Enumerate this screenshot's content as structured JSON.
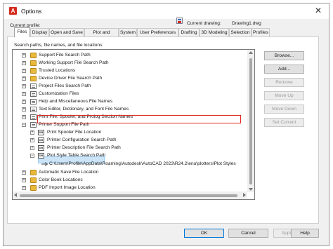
{
  "window": {
    "title": "Options",
    "close_glyph": "✕"
  },
  "header": {
    "current_profile_label": "Current profile:",
    "current_profile_value": "",
    "current_drawing_label": "Current drawing:",
    "current_drawing_value": "Drawing1.dwg"
  },
  "tabs": [
    "Files",
    "Display",
    "Open and Save",
    "Plot and Publish",
    "System",
    "User Preferences",
    "Drafting",
    "3D Modeling",
    "Selection",
    "Profiles"
  ],
  "tree_caption": "Search paths, file names, and file locations:",
  "tree": [
    {
      "label": "Support File Search Path",
      "icon": "folder-icon"
    },
    {
      "label": "Working Support File Search Path",
      "icon": "folder-icon"
    },
    {
      "label": "Trusted Locations",
      "icon": "folder-icon"
    },
    {
      "label": "Device Driver File Search Path",
      "icon": "folder-icon"
    },
    {
      "label": "Project Files Search Path",
      "icon": "document-icon"
    },
    {
      "label": "Customization Files",
      "icon": "document-icon"
    },
    {
      "label": "Help and Miscellaneous File Names",
      "icon": "document-icon"
    },
    {
      "label": "Text Editor, Dictionary, and Font File Names",
      "icon": "document-icon"
    },
    {
      "label": "Print File, Spooler, and Prolog Section Names",
      "icon": "document-icon"
    },
    {
      "label": "Printer Support File Path",
      "icon": "document-icon"
    },
    {
      "label": "Print Spooler File Location",
      "icon": "sub-document-icon"
    },
    {
      "label": "Printer Configuration Search Path",
      "icon": "sub-document-icon"
    },
    {
      "label": "Printer Description File Search Path",
      "icon": "sub-document-icon"
    },
    {
      "label": "Plot Style Table Search Path",
      "icon": "sub-document-icon"
    },
    {
      "label": "C:\\Users\\Profile\\AppData\\Roaming\\Autodesk\\AutoCAD 2023\\R24.2\\enu\\plotters\\Plot Styles",
      "icon": "path-arrow-icon"
    },
    {
      "label": "Automatic Save File Location",
      "icon": "folder-icon"
    },
    {
      "label": "Color Book Locations",
      "icon": "folder-icon"
    },
    {
      "label": "PDF Import Image Location",
      "icon": "folder-icon"
    }
  ],
  "side_buttons": [
    "Browse...",
    "Add...",
    "Remove",
    "Move Up",
    "Move Down",
    "Set Current"
  ],
  "footer_buttons": [
    "OK",
    "Cancel",
    "Apply",
    "Help"
  ],
  "colors": {
    "selection": "#cce4f7",
    "highlight_box": "#e0271f",
    "brand": "#d52b1e"
  }
}
